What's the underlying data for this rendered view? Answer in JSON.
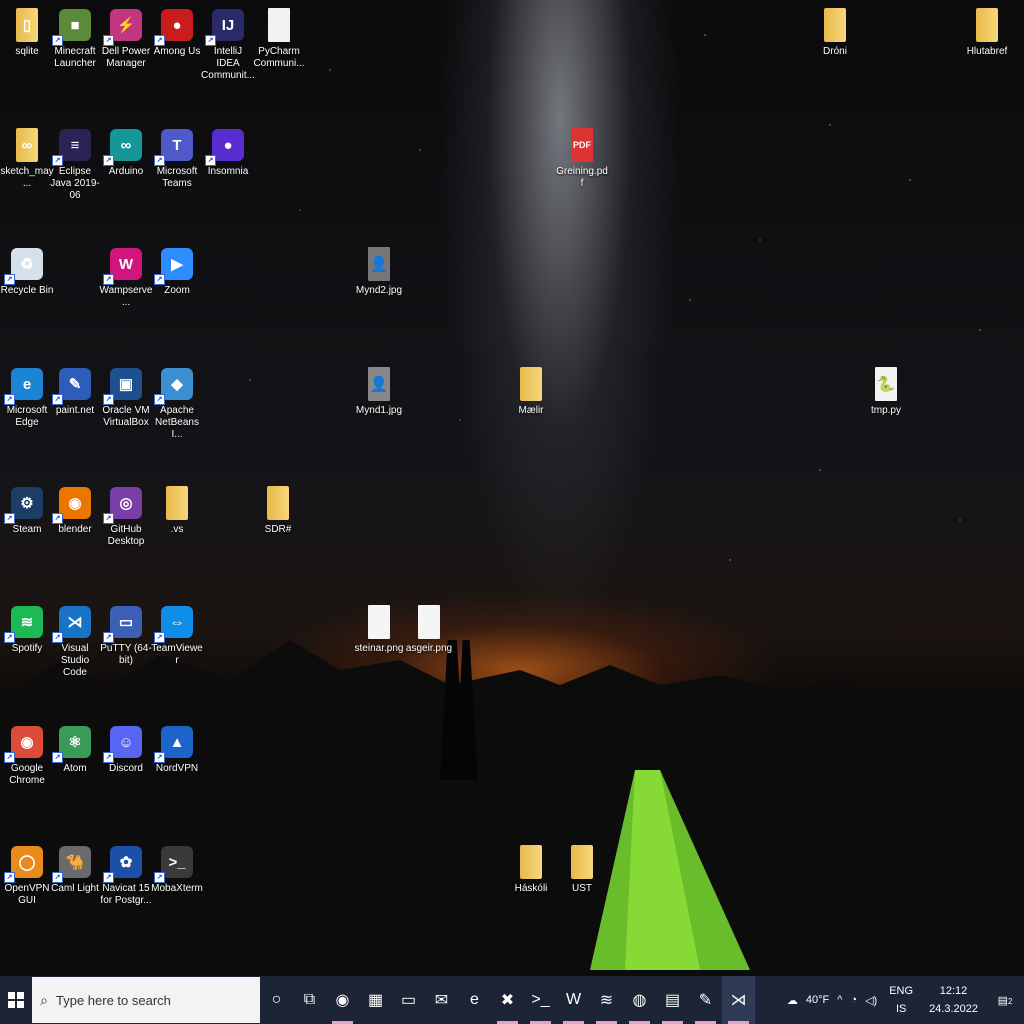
{
  "desktop": {
    "icons": [
      {
        "name": "sqlite",
        "label": "sqlite",
        "glyph": "▯",
        "bg": "#f3d07a",
        "kind": "folder"
      },
      {
        "name": "minecraft-launcher",
        "label": "Minecraft Launcher",
        "glyph": "■",
        "bg": "#5c8a3a",
        "kind": "app"
      },
      {
        "name": "dell-power-manager",
        "label": "Dell Power Manager",
        "glyph": "⚡",
        "bg": "#c0377f",
        "kind": "app"
      },
      {
        "name": "among-us",
        "label": "Among Us",
        "glyph": "●",
        "bg": "#c81d1d",
        "kind": "app"
      },
      {
        "name": "intellij-idea",
        "label": "IntelliJ IDEA Communit...",
        "glyph": "IJ",
        "bg": "#2a2a6a",
        "kind": "app"
      },
      {
        "name": "pycharm",
        "label": "PyCharm Communi...",
        "glyph": "",
        "bg": "#f2f2f2",
        "kind": "file"
      },
      {
        "name": "sketch-may",
        "label": "sketch_may...",
        "glyph": "∞",
        "bg": "#f3d07a",
        "kind": "folder"
      },
      {
        "name": "eclipse-java",
        "label": "Eclipse Java 2019-06",
        "glyph": "≡",
        "bg": "#2c2255",
        "kind": "app"
      },
      {
        "name": "arduino",
        "label": "Arduino",
        "glyph": "∞",
        "bg": "#15979a",
        "kind": "app"
      },
      {
        "name": "microsoft-teams",
        "label": "Microsoft Teams",
        "glyph": "T",
        "bg": "#5059c9",
        "kind": "app"
      },
      {
        "name": "insomnia",
        "label": "Insomnia",
        "glyph": "●",
        "bg": "#5a2dd0",
        "kind": "app"
      },
      {
        "name": "recycle-bin",
        "label": "Recycle Bin",
        "glyph": "♻",
        "bg": "#d6e0ea",
        "kind": "app"
      },
      {
        "name": "wampserver",
        "label": "Wampserve...",
        "glyph": "W",
        "bg": "#d0157f",
        "kind": "app"
      },
      {
        "name": "zoom",
        "label": "Zoom",
        "glyph": "▶",
        "bg": "#2d8cff",
        "kind": "app"
      },
      {
        "name": "microsoft-edge",
        "label": "Microsoft Edge",
        "glyph": "e",
        "bg": "#1b84d4",
        "kind": "app"
      },
      {
        "name": "paint-net",
        "label": "paint.net",
        "glyph": "✎",
        "bg": "#2d5db8",
        "kind": "app"
      },
      {
        "name": "oracle-virtualbox",
        "label": "Oracle VM VirtualBox",
        "glyph": "▣",
        "bg": "#1e4f8e",
        "kind": "app"
      },
      {
        "name": "apache-netbeans",
        "label": "Apache NetBeans I...",
        "glyph": "◆",
        "bg": "#3c8fd0",
        "kind": "app"
      },
      {
        "name": "steam",
        "label": "Steam",
        "glyph": "⚙",
        "bg": "#1b3d66",
        "kind": "app"
      },
      {
        "name": "blender",
        "label": "blender",
        "glyph": "◉",
        "bg": "#ea7600",
        "kind": "app"
      },
      {
        "name": "github-desktop",
        "label": "GitHub Desktop",
        "glyph": "◎",
        "bg": "#7a3fa6",
        "kind": "app"
      },
      {
        "name": "vs-folder",
        "label": ".vs",
        "glyph": "",
        "bg": "#f3d07a",
        "kind": "folder"
      },
      {
        "name": "spotify",
        "label": "Spotify",
        "glyph": "≋",
        "bg": "#1db954",
        "kind": "app"
      },
      {
        "name": "visual-studio-code",
        "label": "Visual Studio Code",
        "glyph": "⋊",
        "bg": "#1873c5",
        "kind": "app"
      },
      {
        "name": "putty",
        "label": "PuTTY (64-bit)",
        "glyph": "▭",
        "bg": "#3c5fb8",
        "kind": "app"
      },
      {
        "name": "teamviewer",
        "label": "TeamViewer",
        "glyph": "⇔",
        "bg": "#0e8ee9",
        "kind": "app"
      },
      {
        "name": "google-chrome",
        "label": "Google Chrome",
        "glyph": "◉",
        "bg": "#dd4b39",
        "kind": "app"
      },
      {
        "name": "atom",
        "label": "Atom",
        "glyph": "⚛",
        "bg": "#3a9a5a",
        "kind": "app"
      },
      {
        "name": "discord",
        "label": "Discord",
        "glyph": "☺",
        "bg": "#5865f2",
        "kind": "app"
      },
      {
        "name": "nordvpn",
        "label": "NordVPN",
        "glyph": "▲",
        "bg": "#1d64c8",
        "kind": "app"
      },
      {
        "name": "openvpn-gui",
        "label": "OpenVPN GUI",
        "glyph": "◯",
        "bg": "#e98a1c",
        "kind": "app"
      },
      {
        "name": "caml-light",
        "label": "Caml Light",
        "glyph": "🐪",
        "bg": "#6a6a6a",
        "kind": "app"
      },
      {
        "name": "navicat",
        "label": "Navicat 15 for Postgr...",
        "glyph": "✿",
        "bg": "#1c4fa8",
        "kind": "app"
      },
      {
        "name": "mobaxterm",
        "label": "MobaXterm",
        "glyph": ">_",
        "bg": "#3a3a3a",
        "kind": "app"
      },
      {
        "name": "droni",
        "label": "Dróni",
        "glyph": "",
        "bg": "#f3d07a",
        "kind": "folder"
      },
      {
        "name": "hlutabref",
        "label": "Hlutabref",
        "glyph": "",
        "bg": "#f3d07a",
        "kind": "folder"
      },
      {
        "name": "greining-pdf",
        "label": "Greining.pdf",
        "glyph": "PDF",
        "bg": "#d33",
        "kind": "file"
      },
      {
        "name": "mynd2-jpg",
        "label": "Mynd2.jpg",
        "glyph": "👤",
        "bg": "#777",
        "kind": "file"
      },
      {
        "name": "mynd1-jpg",
        "label": "Mynd1.jpg",
        "glyph": "👤",
        "bg": "#888",
        "kind": "file"
      },
      {
        "name": "maelir",
        "label": "Mælir",
        "glyph": "",
        "bg": "#f3d07a",
        "kind": "folder"
      },
      {
        "name": "tmp-py",
        "label": "tmp.py",
        "glyph": "🐍",
        "bg": "#f2f2f2",
        "kind": "file"
      },
      {
        "name": "sdr-sharp",
        "label": "SDR#",
        "glyph": "",
        "bg": "#f3d07a",
        "kind": "folder"
      },
      {
        "name": "steinar-png",
        "label": "steinar.png",
        "glyph": "",
        "bg": "#f5f5f5",
        "kind": "file"
      },
      {
        "name": "asgeir-png",
        "label": "asgeir.png",
        "glyph": "",
        "bg": "#f5f5f5",
        "kind": "file"
      },
      {
        "name": "haskoli",
        "label": "Háskóli",
        "glyph": "",
        "bg": "#f3d07a",
        "kind": "folder"
      },
      {
        "name": "ust",
        "label": "UST",
        "glyph": "",
        "bg": "#f3d07a",
        "kind": "folder"
      }
    ]
  },
  "taskbar": {
    "search_placeholder": "Type here to search",
    "apps": [
      {
        "name": "cortana",
        "glyph": "○",
        "active": false
      },
      {
        "name": "task-view",
        "glyph": "⧉",
        "active": false
      },
      {
        "name": "chrome",
        "glyph": "◉",
        "active": true
      },
      {
        "name": "store",
        "glyph": "▦",
        "active": false
      },
      {
        "name": "file-explorer",
        "glyph": "▭",
        "active": false
      },
      {
        "name": "mail",
        "glyph": "✉",
        "active": false
      },
      {
        "name": "edge",
        "glyph": "e",
        "active": false
      },
      {
        "name": "xampp",
        "glyph": "✖",
        "active": true
      },
      {
        "name": "terminal",
        "glyph": ">_",
        "active": true
      },
      {
        "name": "word",
        "glyph": "W",
        "active": true
      },
      {
        "name": "spotify",
        "glyph": "≋",
        "active": true
      },
      {
        "name": "messenger",
        "glyph": "◍",
        "active": true
      },
      {
        "name": "notepad",
        "glyph": "▤",
        "active": true
      },
      {
        "name": "paint",
        "glyph": "✎",
        "active": true
      },
      {
        "name": "vscode",
        "glyph": "⋊",
        "active": true
      }
    ],
    "weather": "40°F",
    "language_top": "ENG",
    "language_bottom": "IS",
    "time": "12:12",
    "date": "24.3.2022",
    "notifications": "2"
  }
}
